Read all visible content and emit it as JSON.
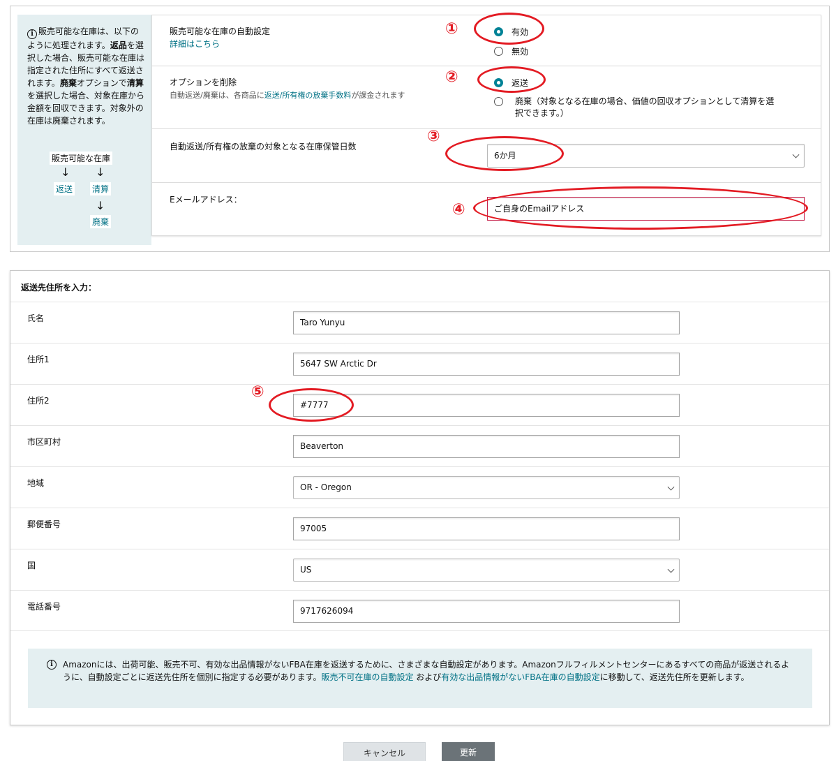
{
  "sidebar_info": {
    "icon": "info-icon",
    "text_html": "販売可能な在庫は、以下のように処理されます。<b>返品</b>を選択した場合、販売可能な在庫は指定された住所にすべて返送されます。<b>廃棄</b>オプションで<b>清算</b>を選択した場合、対象在庫から金額を回収できます。対象外の在庫は廃棄されます。",
    "flow": {
      "top": "販売可能な在庫",
      "left": "返送",
      "right": "清算",
      "bottom": "廃棄"
    }
  },
  "auto_setting": {
    "label": "販売可能な在庫の自動設定",
    "link": "詳細はこちら",
    "option_on": "有効",
    "option_off": "無効"
  },
  "remove_option": {
    "label": "オプションを削除",
    "sub_prefix": "自動返送/廃棄は、各商品に",
    "sub_link": "返送/所有権の放棄手数料",
    "sub_suffix": "が課金されます",
    "option_return": "返送",
    "option_dispose": "廃棄（対象となる在庫の場合、価値の回収オプションとして清算を選択できます。）"
  },
  "storage_days": {
    "label": "自動返送/所有権の放棄の対象となる在庫保管日数",
    "value": "6か月"
  },
  "email": {
    "label": "Eメールアドレス：",
    "value": "ご自身のEmailアドレス"
  },
  "address": {
    "title": "返送先住所を入力：",
    "fields": [
      {
        "label": "氏名",
        "value": "Taro Yunyu",
        "type": "input"
      },
      {
        "label": "住所1",
        "value": "5647 SW Arctic Dr",
        "type": "input"
      },
      {
        "label": "住所2",
        "value": "#7777",
        "type": "input"
      },
      {
        "label": "市区町村",
        "value": "Beaverton",
        "type": "input"
      },
      {
        "label": "地域",
        "value": "OR - Oregon",
        "type": "select"
      },
      {
        "label": "郵便番号",
        "value": "97005",
        "type": "input"
      },
      {
        "label": "国",
        "value": "US",
        "type": "select"
      },
      {
        "label": "電話番号",
        "value": "9717626094",
        "type": "input"
      }
    ]
  },
  "notice": {
    "text1": "Amazonには、出荷可能、販売不可、有効な出品情報がないFBA在庫を返送するために、さまざまな自動設定があります。Amazonフルフィルメントセンターにあるすべての商品が返送されるように、自動設定ごとに返送先住所を個別に指定する必要があります。",
    "link1": "販売不可在庫の自動設定",
    "mid": " および",
    "link2": "有効な出品情報がないFBA在庫の自動設定",
    "text2": "に移動して、返送先住所を更新します。"
  },
  "buttons": {
    "cancel": "キャンセル",
    "update": "更新"
  },
  "annotations": [
    "①",
    "②",
    "③",
    "④",
    "⑤"
  ],
  "colors": {
    "accent": "#008296",
    "link": "#007185",
    "annotation": "#e31b23",
    "info_bg": "#e4eff1"
  }
}
